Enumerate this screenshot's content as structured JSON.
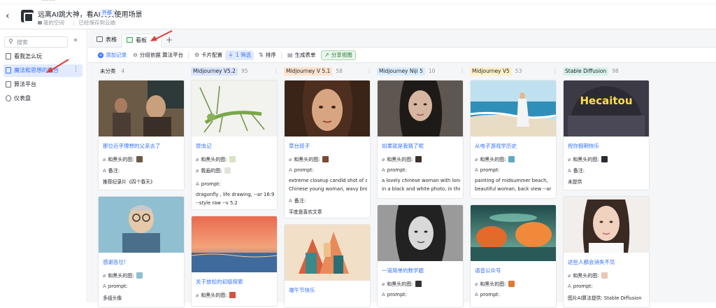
{
  "browser": {
    "url": "......"
  },
  "header": {
    "title": "远离AI跳大神，看AI真实使用场景",
    "tag": "外部",
    "location": "我的空间",
    "save_status": "已经保存到云端"
  },
  "sidebar": {
    "search_placeholder": "搜索",
    "items": [
      {
        "label": "看我怎么玩"
      },
      {
        "label": "魔法和思想的结合"
      },
      {
        "label": "算法平台"
      },
      {
        "label": "仪表盘"
      }
    ]
  },
  "tabs": [
    {
      "label": "表格"
    },
    {
      "label": "看板"
    }
  ],
  "toolbar": {
    "add": "添加记录",
    "group": "分组依据 算法平台",
    "card": "卡片配置",
    "filter": "1 筛选",
    "sort": "排序",
    "form": "生成表单",
    "share": "分享视图"
  },
  "columns": [
    {
      "name": "未分类",
      "count": "4",
      "color": "#f5f6f7"
    },
    {
      "name": "Midjourney V5.2",
      "count": "95",
      "color": "#dbe4ff"
    },
    {
      "name": "Midjourney V 5.1",
      "count": "58",
      "color": "#fde3cf"
    },
    {
      "name": "Midjourney Niji 5",
      "count": "10",
      "color": "#dbeeff"
    },
    {
      "name": "Midjourney V5",
      "count": "53",
      "color": "#fdf0c9"
    },
    {
      "name": "Stable Diffusion",
      "count": "98",
      "color": "#d7f2ec"
    }
  ],
  "cards": {
    "c0a": {
      "title": "那位近乎理想的父亲去了",
      "image_label": "和黑头的图:",
      "f2_label": "备注:",
      "f2_value": "推荐纪录片《四个春天》"
    },
    "c0b": {
      "title": "感谢各位!",
      "image_label": "和黑头的图:",
      "f2_label": "prompt:",
      "f2_value": "多组头像"
    },
    "c1a": {
      "title": "昆虫记",
      "image_label": "和黑头的图:",
      "f2_label": "我画的图:",
      "f3_label": "prompt:",
      "f3_value1": "dragonfly , life drawing, --ar 16:9",
      "f3_value2": "--style raw  --v 5.2"
    },
    "c1b": {
      "title": "关于放松的初级探索",
      "image_label": "和黑头的图:"
    },
    "c2a": {
      "title": "草台班子",
      "image_label": "和黑头的图:",
      "f2_label": "prompt:",
      "f2_value1": "extreme closeup candid shot of a",
      "f2_value2": "Chinese young woman, wavy brown...",
      "f3_label": "备注:",
      "f3_value": "平度是喜欢文章"
    },
    "c2b": {
      "title": "端午节快乐"
    },
    "c3a": {
      "title": "如果就是我猜了呢",
      "image_label": "和黑头的图:",
      "f2_label": "prompt:",
      "f2_value1": "a lovely chinese woman with long hair",
      "f2_value2": "in a black and white photo, in the sty..."
    },
    "c3b": {
      "title": "一道简单的数学题",
      "image_label": "和黑头的图:",
      "f2_label": "prompt:"
    },
    "c4a": {
      "title": "从电子游戏学历史",
      "image_label": "和黑头的图:",
      "f2_label": "prompt:",
      "f2_value1": "painting of midsummer beach,",
      "f2_value2": "beautiful woman, back view --ar 16:9..."
    },
    "c4b": {
      "title": "语音公众号",
      "image_label": "和黑头的图:",
      "f2_label": "prompt:"
    },
    "c5a": {
      "title": "祝你假期快乐",
      "image_label": "和黑头的图:",
      "f2_label": "备注:",
      "f2_value": "未提供"
    },
    "c5b": {
      "title": "这些人都会消失不见",
      "image_label": "和黑头的图:",
      "f2_label": "prompt:",
      "f2_value": "图片AI算法提供: Stable Diffusion"
    }
  },
  "hat_text": "Hecaitou",
  "colors": {
    "accent": "#3370ff",
    "annotation_arrow": "#e53935"
  }
}
